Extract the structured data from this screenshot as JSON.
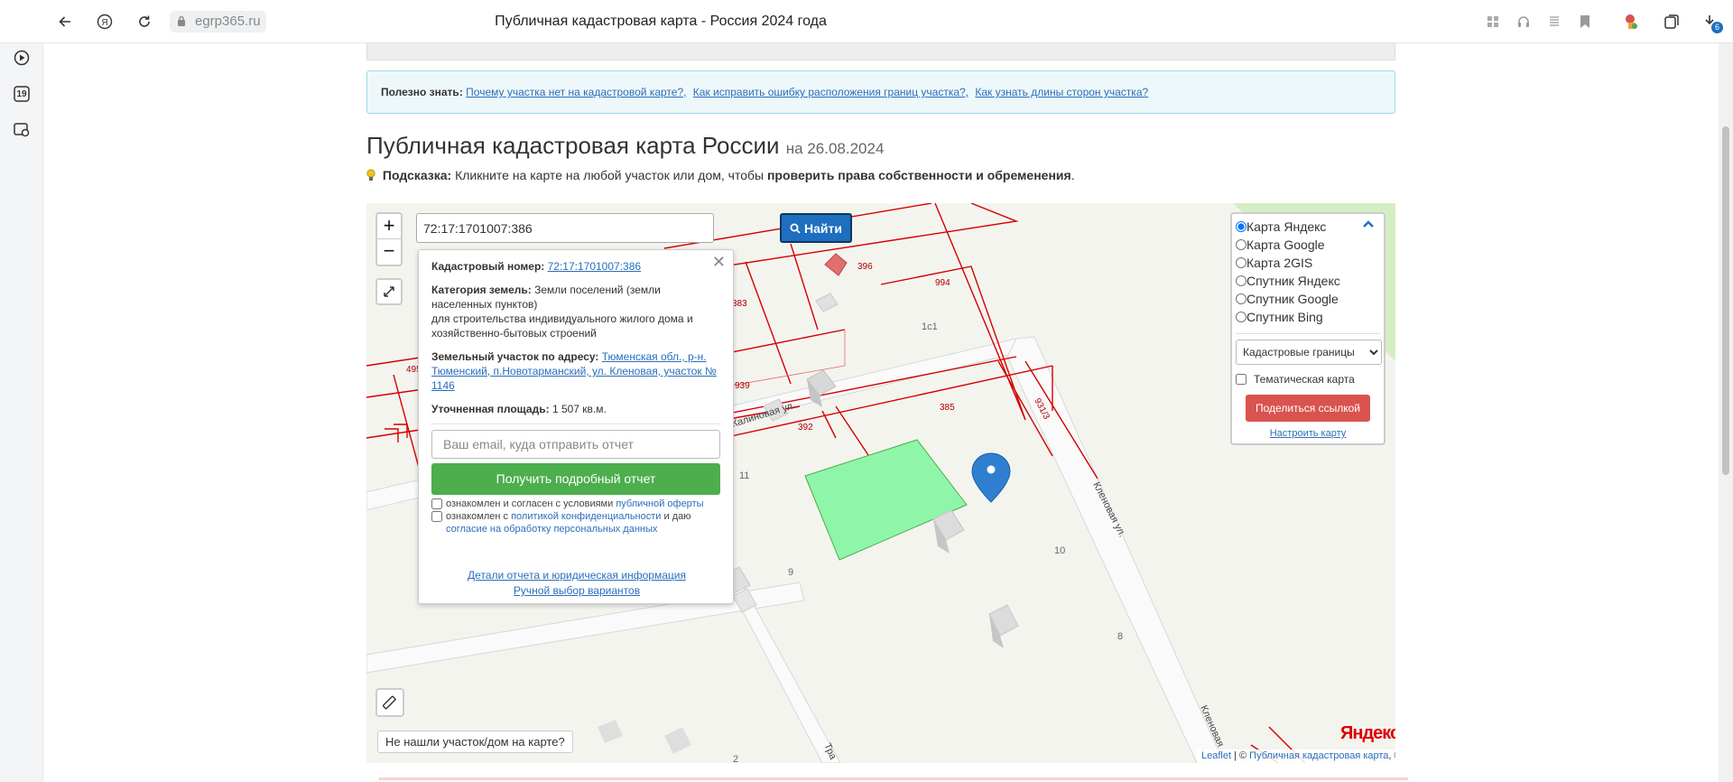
{
  "browser": {
    "url": "egrp365.ru",
    "title": "Публичная кадастровая карта - Россия 2024 года",
    "download_badge": "6",
    "sidebar_badge": "19"
  },
  "info": {
    "label": "Полезно знать:",
    "links": [
      "Почему участка нет на кадастровой карте?,",
      "Как исправить ошибку расположения границ участка?,",
      "Как узнать длины сторон участка?"
    ]
  },
  "heading": {
    "title": "Публичная кадастровая карта России",
    "date": "на 26.08.2024"
  },
  "hint": {
    "label": "Подсказка:",
    "text": "Кликните на карте на любой участок или дом, чтобы",
    "bold": "проверить права собственности и обременения",
    "end": "."
  },
  "map": {
    "zoom_in": "+",
    "zoom_out": "−",
    "search_value": "72:17:1701007:386",
    "search_button": "Найти",
    "not_found": "Не нашли участок/дом на карте?",
    "yandex_logo": "Яндекс",
    "attribution_leaflet": "Leaflet",
    "attribution_sep": " | © ",
    "attribution_pkk": "Публичная кадастровая карта",
    "attribution_end": ", ©",
    "parcel_labels": [
      "396",
      "994",
      "383",
      "1с1",
      "495",
      "939",
      "931/3",
      "392",
      "385",
      "11",
      "10",
      "9",
      "8",
      "2"
    ],
    "street_labels": [
      "Калиновая ул.",
      "Кленовая ул.",
      "Кленовая",
      "Тра"
    ]
  },
  "popup": {
    "cad_label": "Кадастровый номер:",
    "cad_value": "72:17:1701007:386",
    "cat_label": "Категория земель:",
    "cat_value": "Земли поселений (земли населенных пунктов)",
    "cat_use": "для строительства индивидуального жилого дома и хозяйственно-бытовых строений",
    "addr_label": "Земельный участок по адресу:",
    "addr_value": "Тюменская обл., р-н. Тюменский, п.Новотарманский, ул. Кленовая, участок № 1146",
    "area_label": "Уточненная площадь:",
    "area_value": "1 507 кв.м.",
    "email_placeholder": "Ваш email, куда отправить отчет",
    "report_button": "Получить подробный отчет",
    "chk1_text": "ознакомлен и согласен с условиями",
    "chk1_link": "публичной оферты",
    "chk2_text": "ознакомлен с",
    "chk2_link": "политикой конфиденциальности",
    "chk2_mid": "и даю",
    "chk2_link2": "согласие на обработку персональных данных",
    "details_link": "Детали отчета и юридическая информация",
    "manual_link": "Ручной выбор вариантов",
    "close": "✕"
  },
  "layers": {
    "options": [
      "Карта Яндекс",
      "Карта Google",
      "Карта 2GIS",
      "Спутник Яндекс",
      "Спутник Google",
      "Спутник Bing"
    ],
    "selected": "Карта Яндекс",
    "select_value": "Кадастровые границы",
    "thematic": "Тематическая карта",
    "share": "Поделиться ссылкой",
    "configure": "Настроить карту"
  },
  "colors": {
    "accent": "#1e6fbf",
    "green": "#4cae4c",
    "red": "#d9534f",
    "parcel": "#d40000",
    "selected_parcel": "#8ff5a8"
  }
}
